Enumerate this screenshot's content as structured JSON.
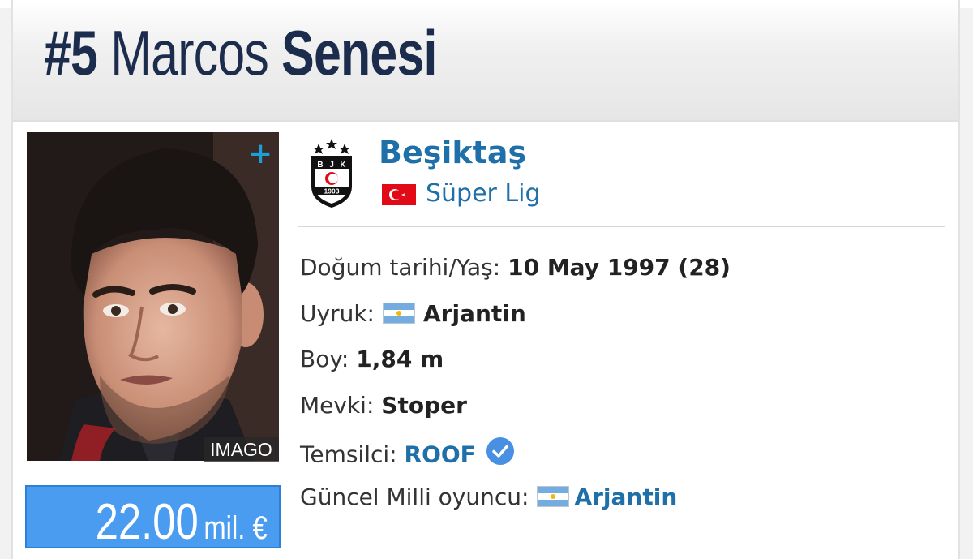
{
  "header": {
    "number": "#5",
    "first_name": "Marcos",
    "last_name": "Senesi"
  },
  "photo": {
    "credit": "IMAGO",
    "expand_icon": "plus-icon"
  },
  "market_value": {
    "amount": "22.00",
    "unit": "mil. €"
  },
  "club": {
    "name": "Beşiktaş",
    "logo_icon": "club-crest-icon",
    "logo_year": "1903",
    "logo_letters": [
      "B",
      "J",
      "K"
    ],
    "league": "Süper Lig",
    "league_flag_icon": "turkey-flag-icon"
  },
  "details": {
    "birth": {
      "label": "Doğum tarihi/Yaş:",
      "value": "10 May 1997 (28)"
    },
    "nationality": {
      "label": "Uyruk:",
      "value": "Arjantin",
      "flag_icon": "argentina-flag-icon"
    },
    "height": {
      "label": "Boy:",
      "value": "1,84 m"
    },
    "position": {
      "label": "Mevki:",
      "value": "Stoper"
    },
    "agent": {
      "label": "Temsilci:",
      "value": "ROOF",
      "verified_icon": "verified-check-icon"
    },
    "national_team": {
      "label": "Güncel Milli oyuncu:",
      "value": "Arjantin",
      "flag_icon": "argentina-flag-icon"
    }
  },
  "colors": {
    "title": "#1b2c4c",
    "link": "#1f6fa8",
    "value_box": "#4a9cf0",
    "plus": "#1a9fd8",
    "turkey_red": "#e30a17",
    "argentina_blue": "#74acdf",
    "verified": "#4a90e2"
  }
}
